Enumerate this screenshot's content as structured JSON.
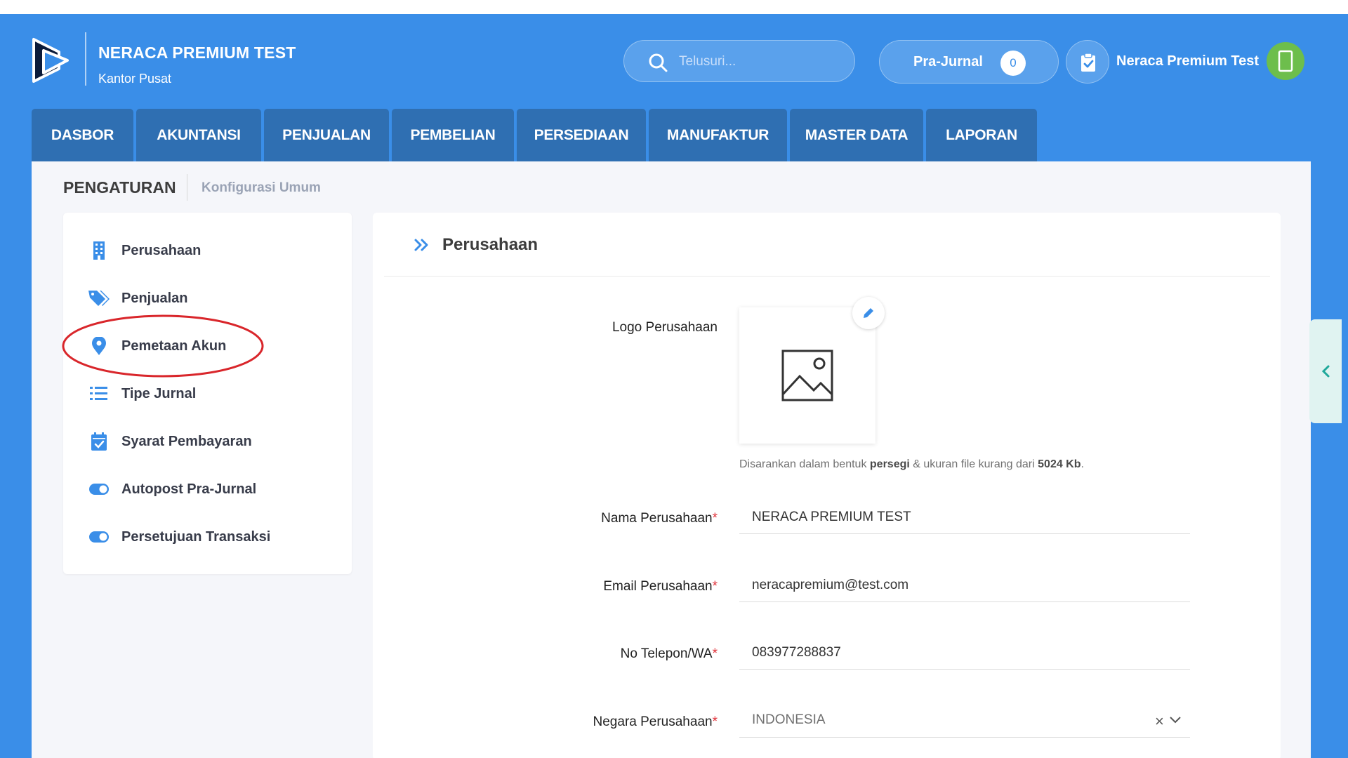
{
  "brand": {
    "name": "NERACA PREMIUM TEST",
    "sub": "Kantor Pusat"
  },
  "search": {
    "placeholder": "Telusuri..."
  },
  "prajurnal": {
    "label": "Pra-Jurnal",
    "count": "0"
  },
  "user": {
    "name": "Neraca Premium Test"
  },
  "nav": [
    {
      "label": "DASBOR",
      "w": 145
    },
    {
      "label": "AKUNTANSI",
      "w": 178
    },
    {
      "label": "PENJUALAN",
      "w": 178
    },
    {
      "label": "PEMBELIAN",
      "w": 174
    },
    {
      "label": "PERSEDIAAN",
      "w": 184
    },
    {
      "label": "MANUFAKTUR",
      "w": 197
    },
    {
      "label": "MASTER DATA",
      "w": 190
    },
    {
      "label": "LAPORAN",
      "w": 158
    }
  ],
  "page": {
    "title": "PENGATURAN",
    "crumb": "Konfigurasi Umum"
  },
  "sidebar": {
    "items": [
      {
        "label": "Perusahaan"
      },
      {
        "label": "Penjualan"
      },
      {
        "label": "Pemetaan Akun"
      },
      {
        "label": "Tipe Jurnal"
      },
      {
        "label": "Syarat Pembayaran"
      },
      {
        "label": "Autopost Pra-Jurnal"
      },
      {
        "label": "Persetujuan Transaksi"
      }
    ]
  },
  "main": {
    "heading": "Perusahaan",
    "logo_label": "Logo Perusahaan",
    "note_pre": "Disarankan dalam bentuk ",
    "note_b1": "persegi",
    "note_mid": " & ukuran file kurang dari ",
    "note_b2": "5024 Kb",
    "note_end": ".",
    "fields": {
      "nama": {
        "label": "Nama Perusahaan",
        "value": "NERACA PREMIUM TEST"
      },
      "email": {
        "label": "Email Perusahaan",
        "value": "neracapremium@test.com"
      },
      "telp": {
        "label": "No Telepon/WA",
        "value": "083977288837"
      },
      "negara": {
        "label": "Negara Perusahaan",
        "value": "INDONESIA"
      }
    },
    "required_mark": "*"
  },
  "colors": {
    "header_blue": "#3a8ee8",
    "nav_tab": "#2f6fb2",
    "accent_icon": "#3a8ee8",
    "annotation": "#d9262b"
  }
}
